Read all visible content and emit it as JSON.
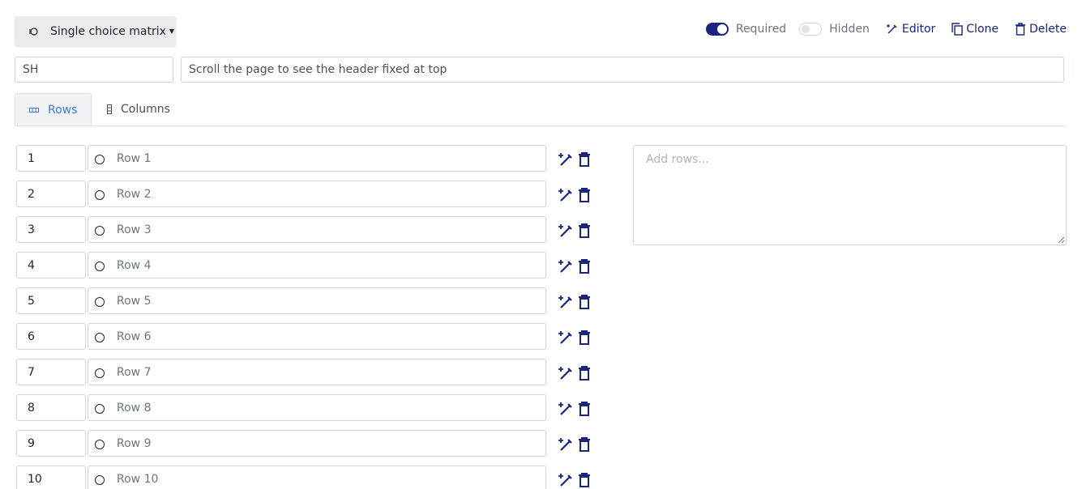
{
  "header": {
    "question_type": "Single choice matrix",
    "toggles": {
      "required_label": "Required",
      "required_on": true,
      "hidden_label": "Hidden",
      "hidden_on": false
    },
    "actions": {
      "editor": "Editor",
      "clone": "Clone",
      "delete": "Delete"
    }
  },
  "question": {
    "code": "SH",
    "title_placeholder": "Scroll the page to see the header fixed at top"
  },
  "tabs": [
    {
      "label": "Rows",
      "active": true
    },
    {
      "label": "Columns",
      "active": false
    }
  ],
  "rows": [
    {
      "code": "1",
      "label": "Row 1"
    },
    {
      "code": "2",
      "label": "Row 2"
    },
    {
      "code": "3",
      "label": "Row 3"
    },
    {
      "code": "4",
      "label": "Row 4"
    },
    {
      "code": "5",
      "label": "Row 5"
    },
    {
      "code": "6",
      "label": "Row 6"
    },
    {
      "code": "7",
      "label": "Row 7"
    },
    {
      "code": "8",
      "label": "Row 8"
    },
    {
      "code": "9",
      "label": "Row 9"
    },
    {
      "code": "10",
      "label": "Row 10"
    }
  ],
  "add_rows_placeholder": "Add rows...",
  "colors": {
    "accent": "#1a237e",
    "tab_active_text": "#3a7bd5"
  }
}
